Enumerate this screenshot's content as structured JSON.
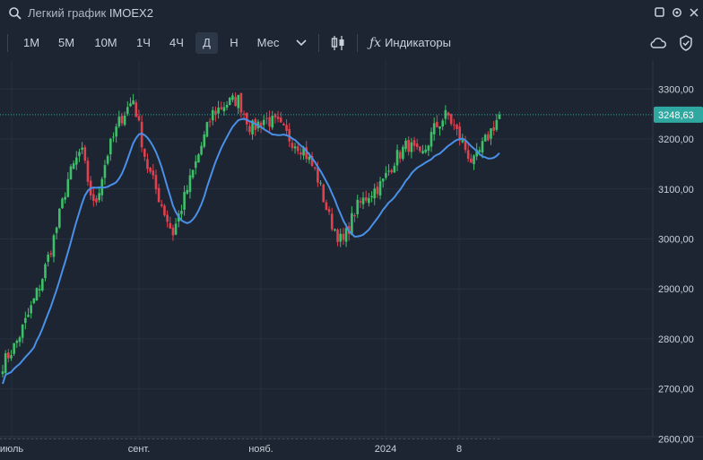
{
  "window": {
    "title_label": "Легкий график",
    "symbol": "IMOEX2"
  },
  "toolbar": {
    "timeframes": [
      "1М",
      "5М",
      "10М",
      "1Ч",
      "4Ч",
      "Д",
      "Н",
      "Мес"
    ],
    "active_timeframe": "Д",
    "indicators_label": "Индикаторы"
  },
  "colors": {
    "background": "#1c2531",
    "up_candle": "#3fbf6a",
    "down_candle": "#e0414f",
    "ma_line": "#4a8fe8",
    "price_tag": "#2ea8a0"
  },
  "chart_data": {
    "type": "candlestick",
    "symbol": "IMOEX2",
    "interval": "Д",
    "y_ticks": [
      "2600,00",
      "2700,00",
      "2800,00",
      "2900,00",
      "3000,00",
      "3100,00",
      "3200,00",
      "3300,00"
    ],
    "x_ticks": [
      "июль",
      "сент.",
      "нояб.",
      "2024",
      "8"
    ],
    "last_price": "3248,63",
    "ylim": [
      2590,
      3340
    ],
    "grid": true,
    "series": [
      {
        "kind": "ohlc",
        "closes_by_month": {
          "июль": [
            2750,
            2790,
            2850,
            2920
          ],
          "авг.": [
            3010,
            3120,
            3180,
            3060,
            3170
          ],
          "сент.": [
            3240,
            3280,
            3150,
            3080,
            3010
          ],
          "окт.": [
            3090,
            3170,
            3250,
            3270,
            3280
          ],
          "нояб.": [
            3220,
            3240,
            3230,
            3200,
            3180
          ],
          "дек.": [
            3130,
            3040,
            2990,
            3060,
            3090
          ],
          "2024 янв.": [
            3110,
            3160,
            3190,
            3160,
            3220,
            3250
          ],
          "2024 февр.": [
            3200,
            3150,
            3200,
            3248.63
          ]
        }
      },
      {
        "kind": "moving_average",
        "color": "#4a8fe8"
      }
    ]
  }
}
